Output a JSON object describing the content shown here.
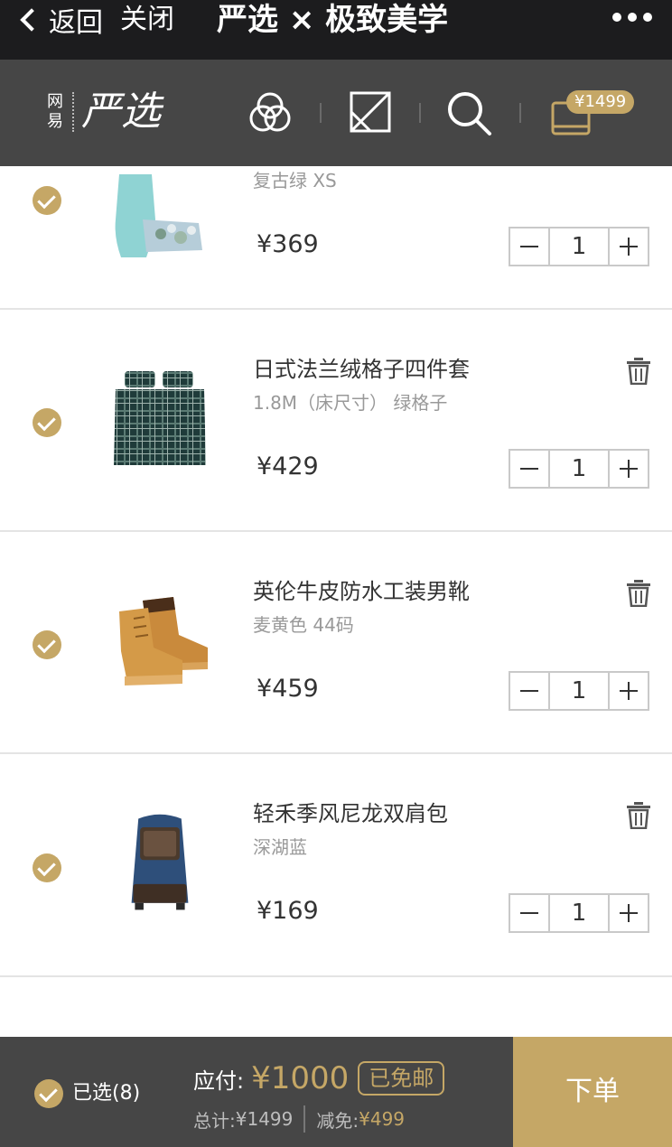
{
  "topbar": {
    "back": "返回",
    "close": "关闭",
    "title": "严选 × 极致美学"
  },
  "nav": {
    "logo_small": "网易",
    "logo_big": "严选",
    "cart_amount": "¥1499"
  },
  "items": [
    {
      "name": "",
      "spec": "复古绿 XS",
      "price": "¥369",
      "qty": "1"
    },
    {
      "name": "日式法兰绒格子四件套",
      "spec": "1.8M（床尺寸） 绿格子",
      "price": "¥429",
      "qty": "1"
    },
    {
      "name": "英伦牛皮防水工装男靴",
      "spec": "麦黄色 44码",
      "price": "¥459",
      "qty": "1"
    },
    {
      "name": "轻禾季风尼龙双肩包",
      "spec": "深湖蓝",
      "price": "¥169",
      "qty": "1"
    }
  ],
  "footer": {
    "selected": "已选(8)",
    "pay_label": "应付:",
    "pay_amount": "¥1000",
    "free_shipping": "已免邮",
    "total_label": "总计:",
    "total": "¥1499",
    "discount_label": "减免:",
    "discount": "¥499",
    "order_button": "下单"
  },
  "colors": {
    "accent": "#c5a766",
    "dark": "#464646",
    "topbar": "#1c1c1e"
  }
}
